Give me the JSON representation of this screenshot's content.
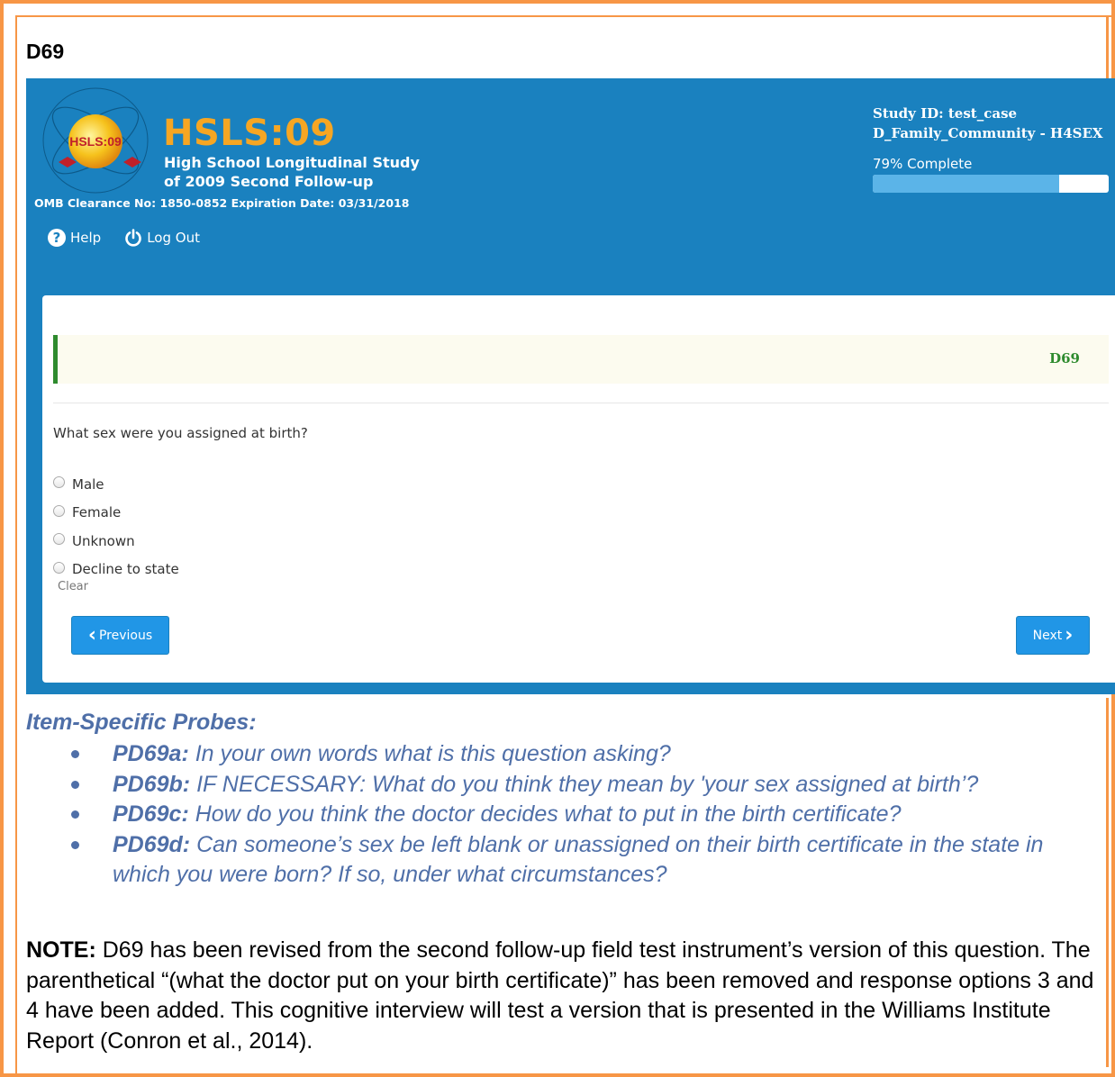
{
  "doc": {
    "heading": "D69"
  },
  "header": {
    "logo_text": "HSLS:09",
    "title": "HSLS:09",
    "subtitle_line1": "High School Longitudinal Study",
    "subtitle_line2": "of 2009 Second Follow-up",
    "omb": "OMB Clearance No: 1850-0852 Expiration Date: 03/31/2018",
    "help_label": "Help",
    "logout_label": "Log Out",
    "study_id": "Study ID: test_case",
    "section": "D_Family_Community - H4SEX",
    "progress_text": "79% Complete",
    "progress_value": 0.79
  },
  "question": {
    "id": "D69",
    "text": "What sex were you assigned at birth?",
    "options": [
      "Male",
      "Female",
      "Unknown",
      "Decline to state"
    ],
    "clear_label": "Clear",
    "previous_label": "Previous",
    "next_label": "Next"
  },
  "probes": {
    "title": "Item-Specific Probes:",
    "items": [
      {
        "id": "PD69a:",
        "text": " In your own words what is this question asking?"
      },
      {
        "id": "PD69b:",
        "text": " IF NECESSARY: What do you think they mean by 'your sex assigned at birth’?"
      },
      {
        "id": "PD69c:",
        "text": " How do you think the doctor decides what to put in the birth certificate?"
      },
      {
        "id": "PD69d:",
        "text": " Can someone’s sex be left blank or unassigned on their birth certificate in the state in which you were born?  If so, under what circumstances?"
      }
    ]
  },
  "note": {
    "label": "NOTE:",
    "text": " D69 has been revised from the second follow-up field test instrument’s version of this question.  The parenthetical “(what the doctor put on your birth certificate)” has been removed and response options 3 and 4 have been added.  This cognitive interview will test a version that is presented in the Williams Institute Report (Conron et al., 2014)."
  },
  "colors": {
    "frame": "#f79646",
    "header_bg": "#1a81bf",
    "accent_green": "#2e8b2e",
    "probe_text": "#4f6fa8",
    "button": "#2196e6"
  }
}
